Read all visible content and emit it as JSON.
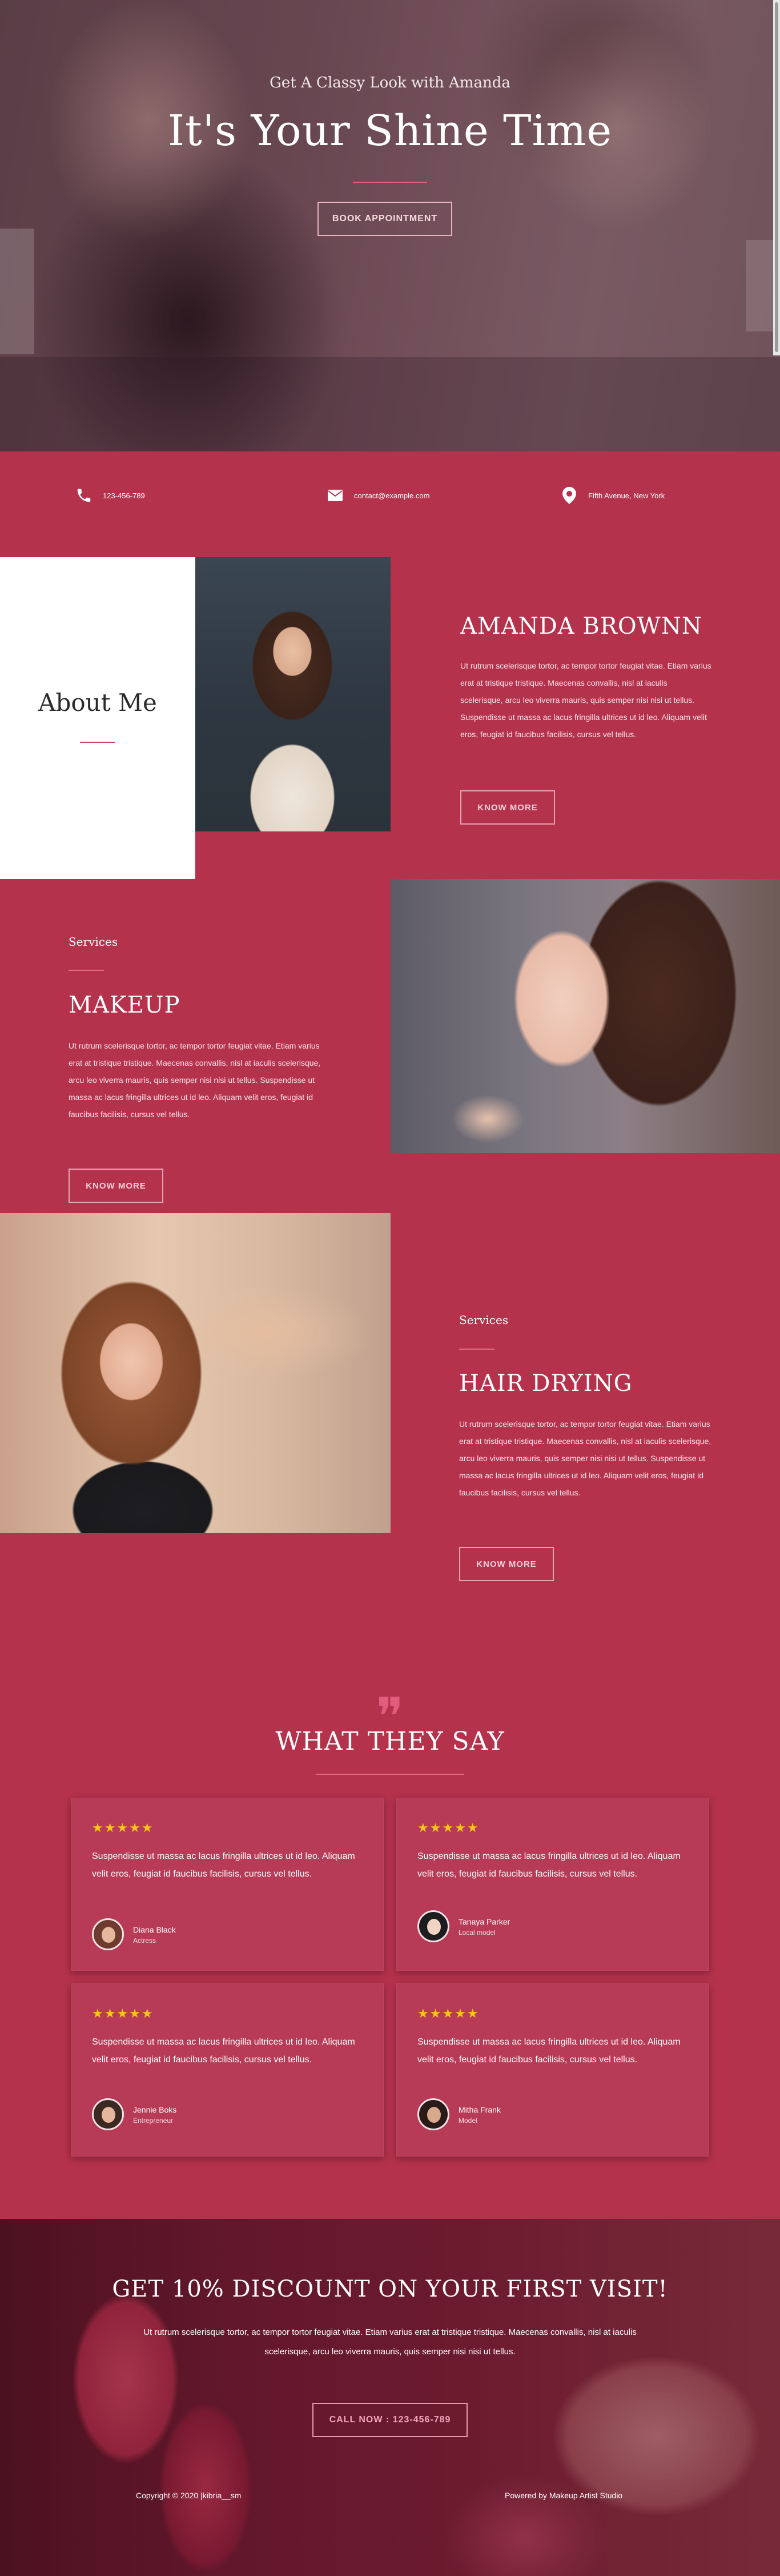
{
  "hero": {
    "subtitle": "Get A Classy Look with Amanda",
    "title": "It's Your Shine Time",
    "button": "BOOK APPOINTMENT"
  },
  "contact": {
    "phone": "123-456-789",
    "email": "contact@example.com",
    "address": "Fifth Avenue, New York"
  },
  "about": {
    "heading": "About Me",
    "name": "AMANDA BROWNN",
    "text": "Ut rutrum scelerisque tortor, ac tempor tortor feugiat vitae. Etiam varius erat at tristique tristique. Maecenas convallis, nisl at iaculis scelerisque, arcu leo viverra mauris, quis semper nisi nisi ut tellus. Suspendisse ut massa ac lacus fringilla ultrices ut id leo. Aliquam velit eros, feugiat id faucibus facilisis, cursus vel tellus.",
    "button": "KNOW MORE"
  },
  "services": [
    {
      "label": "Services",
      "title": "MAKEUP",
      "text": "Ut rutrum scelerisque tortor, ac tempor tortor feugiat vitae. Etiam varius erat at tristique tristique. Maecenas convallis, nisl at iaculis scelerisque, arcu leo viverra mauris, quis semper nisi nisi ut tellus. Suspendisse ut massa ac lacus fringilla ultrices ut id leo. Aliquam velit eros, feugiat id faucibus facilisis, cursus vel tellus.",
      "button": "KNOW MORE"
    },
    {
      "label": "Services",
      "title": "HAIR DRYING",
      "text": "Ut rutrum scelerisque tortor, ac tempor tortor feugiat vitae. Etiam varius erat at tristique tristique. Maecenas convallis, nisl at iaculis scelerisque, arcu leo viverra mauris, quis semper nisi nisi ut tellus. Suspendisse ut massa ac lacus fringilla ultrices ut id leo. Aliquam velit eros, feugiat id faucibus facilisis, cursus vel tellus.",
      "button": "KNOW MORE"
    }
  ],
  "testimonials": {
    "quote_mark": "❞",
    "title": "WHAT THEY SAY",
    "stars": "★★★★★",
    "items": [
      {
        "text": "Suspendisse ut massa ac lacus fringilla ultrices ut id leo. Aliquam velit eros, feugiat id faucibus facilisis, cursus vel tellus.",
        "name": "Diana Black",
        "role": "Actress"
      },
      {
        "text": "Suspendisse ut massa ac lacus fringilla ultrices ut id leo. Aliquam velit eros, feugiat id faucibus facilisis, cursus vel tellus.",
        "name": "Tanaya Parker",
        "role": "Local model"
      },
      {
        "text": "Suspendisse ut massa ac lacus fringilla ultrices ut id leo. Aliquam velit eros, feugiat id faucibus facilisis, cursus vel tellus.",
        "name": "Jennie Boks",
        "role": "Entrepreneur"
      },
      {
        "text": "Suspendisse ut massa ac lacus fringilla ultrices ut id leo. Aliquam velit eros, feugiat id faucibus facilisis, cursus vel tellus.",
        "name": "Mitha Frank",
        "role": "Model"
      }
    ]
  },
  "promo": {
    "title": "GET 10% DISCOUNT ON YOUR FIRST VISIT!",
    "text": "Ut rutrum scelerisque tortor, ac tempor tortor feugiat vitae. Etiam varius erat at tristique tristique. Maecenas convallis, nisl at iaculis scelerisque, arcu leo viverra mauris, quis semper nisi nisi ut tellus.",
    "button": "CALL NOW : 123-456-789"
  },
  "footer": {
    "copyright": "Copyright © 2020 |kibria__sm",
    "powered": "Powered by Makeup Artist Studio"
  },
  "colors": {
    "brand": "#b5324c",
    "accent": "#e0607a",
    "star": "#f5c518"
  }
}
